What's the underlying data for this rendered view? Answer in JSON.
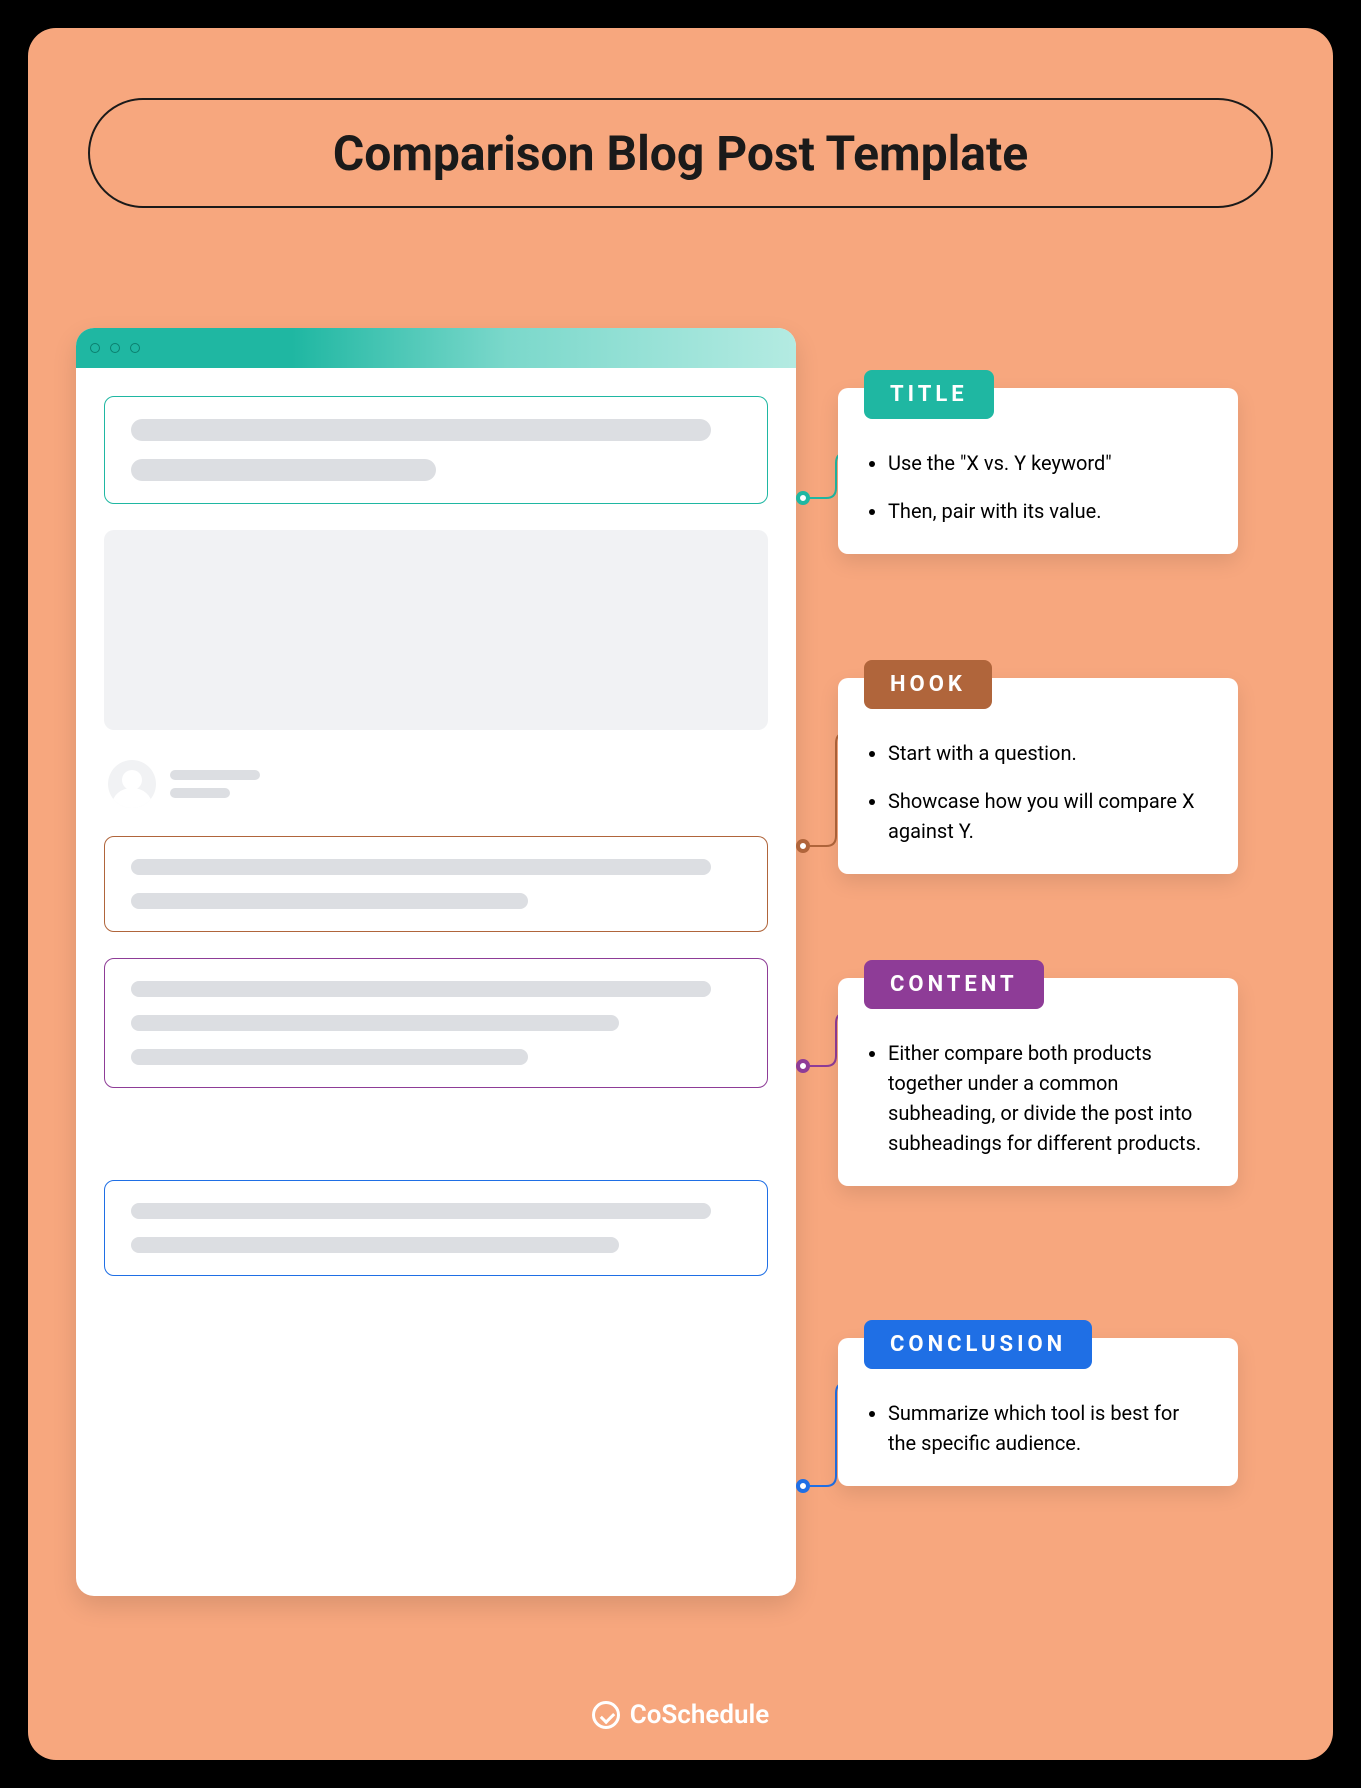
{
  "page_title": "Comparison Blog Post Template",
  "brand": "CoSchedule",
  "callouts": {
    "title": {
      "tag": "TITLE",
      "bullets": [
        "Use the \"X vs. Y keyword\"",
        "Then, pair with its value."
      ]
    },
    "hook": {
      "tag": "HOOK",
      "bullets": [
        "Start with a question.",
        "Showcase how you will compare X against Y."
      ]
    },
    "content": {
      "tag": "CONTENT",
      "bullets": [
        "Either compare both products together under a common subheading, or divide the post into subheadings for different products."
      ]
    },
    "conclusion": {
      "tag": "CONCLUSION",
      "bullets": [
        "Summarize which tool is best for the specific audience."
      ]
    }
  },
  "colors": {
    "title": "#1FB7A2",
    "hook": "#B0653B",
    "content": "#8E3C97",
    "conclusion": "#1F6FE5"
  }
}
